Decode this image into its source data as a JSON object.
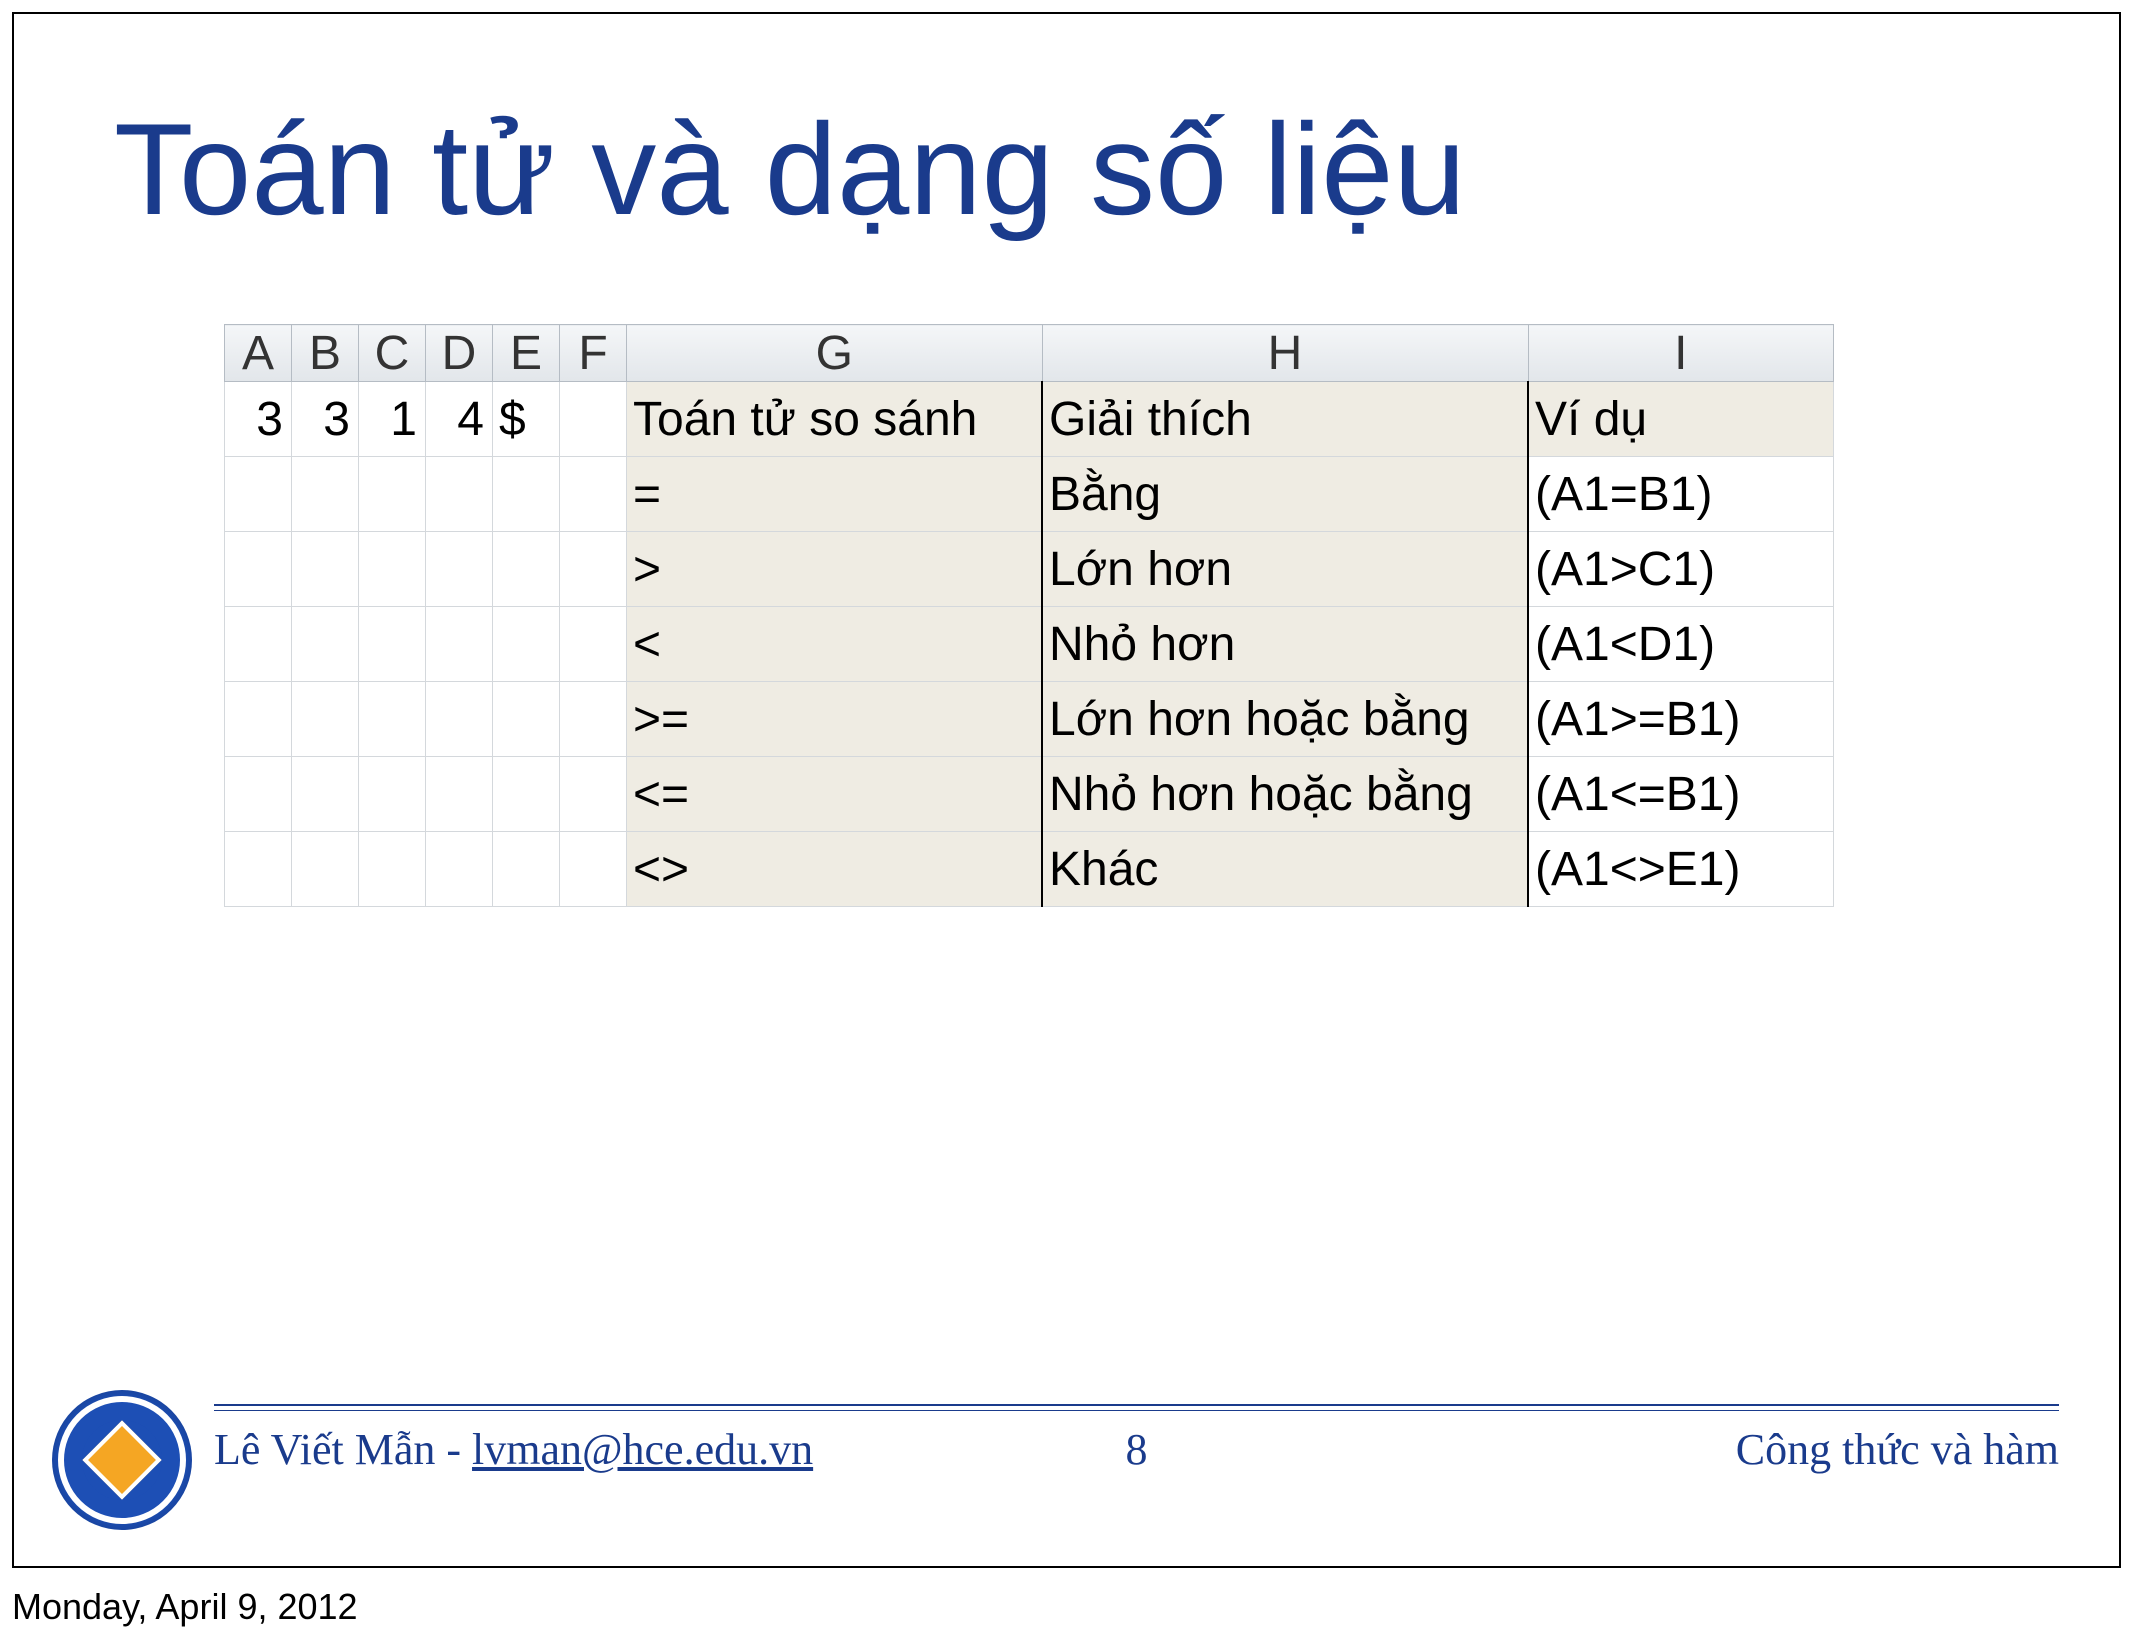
{
  "title": "Toán tử và dạng số liệu",
  "columns": [
    "A",
    "B",
    "C",
    "D",
    "E",
    "F",
    "G",
    "H",
    "I"
  ],
  "rows": [
    {
      "A": "3",
      "B": "3",
      "C": "1",
      "D": "4",
      "E": "$",
      "F": "",
      "G": "Toán tử so sánh",
      "H": "Giải thích",
      "I": "Ví dụ",
      "shadeG": true,
      "shadeH": true,
      "shadeI": true,
      "numA": true,
      "numB": true,
      "numC": true,
      "numD": true
    },
    {
      "A": "",
      "B": "",
      "C": "",
      "D": "",
      "E": "",
      "F": "",
      "G": "=",
      "H": "Bằng",
      "I": "(A1=B1)",
      "shadeG": true,
      "shadeH": true
    },
    {
      "A": "",
      "B": "",
      "C": "",
      "D": "",
      "E": "",
      "F": "",
      "G": ">",
      "H": "Lớn hơn",
      "I": "(A1>C1)",
      "shadeG": true,
      "shadeH": true
    },
    {
      "A": "",
      "B": "",
      "C": "",
      "D": "",
      "E": "",
      "F": "",
      "G": "<",
      "H": "Nhỏ hơn",
      "I": "(A1<D1)",
      "shadeG": true,
      "shadeH": true
    },
    {
      "A": "",
      "B": "",
      "C": "",
      "D": "",
      "E": "",
      "F": "",
      "G": ">=",
      "H": "Lớn hơn hoặc bằng",
      "I": "(A1>=B1)",
      "shadeG": true,
      "shadeH": true
    },
    {
      "A": "",
      "B": "",
      "C": "",
      "D": "",
      "E": "",
      "F": "",
      "G": "<=",
      "H": "Nhỏ hơn hoặc bằng",
      "I": "(A1<=B1)",
      "shadeG": true,
      "shadeH": true
    },
    {
      "A": "",
      "B": "",
      "C": "",
      "D": "",
      "E": "",
      "F": "",
      "G": "<>",
      "H": "Khác",
      "I": "(A1<>E1)",
      "shadeG": true,
      "shadeH": true
    }
  ],
  "footer": {
    "author": "Lê Viết Mẫn - ",
    "email": "lvman@hce.edu.vn",
    "page": "8",
    "topic": "Công thức và hàm"
  },
  "date": "Monday, April 9, 2012"
}
